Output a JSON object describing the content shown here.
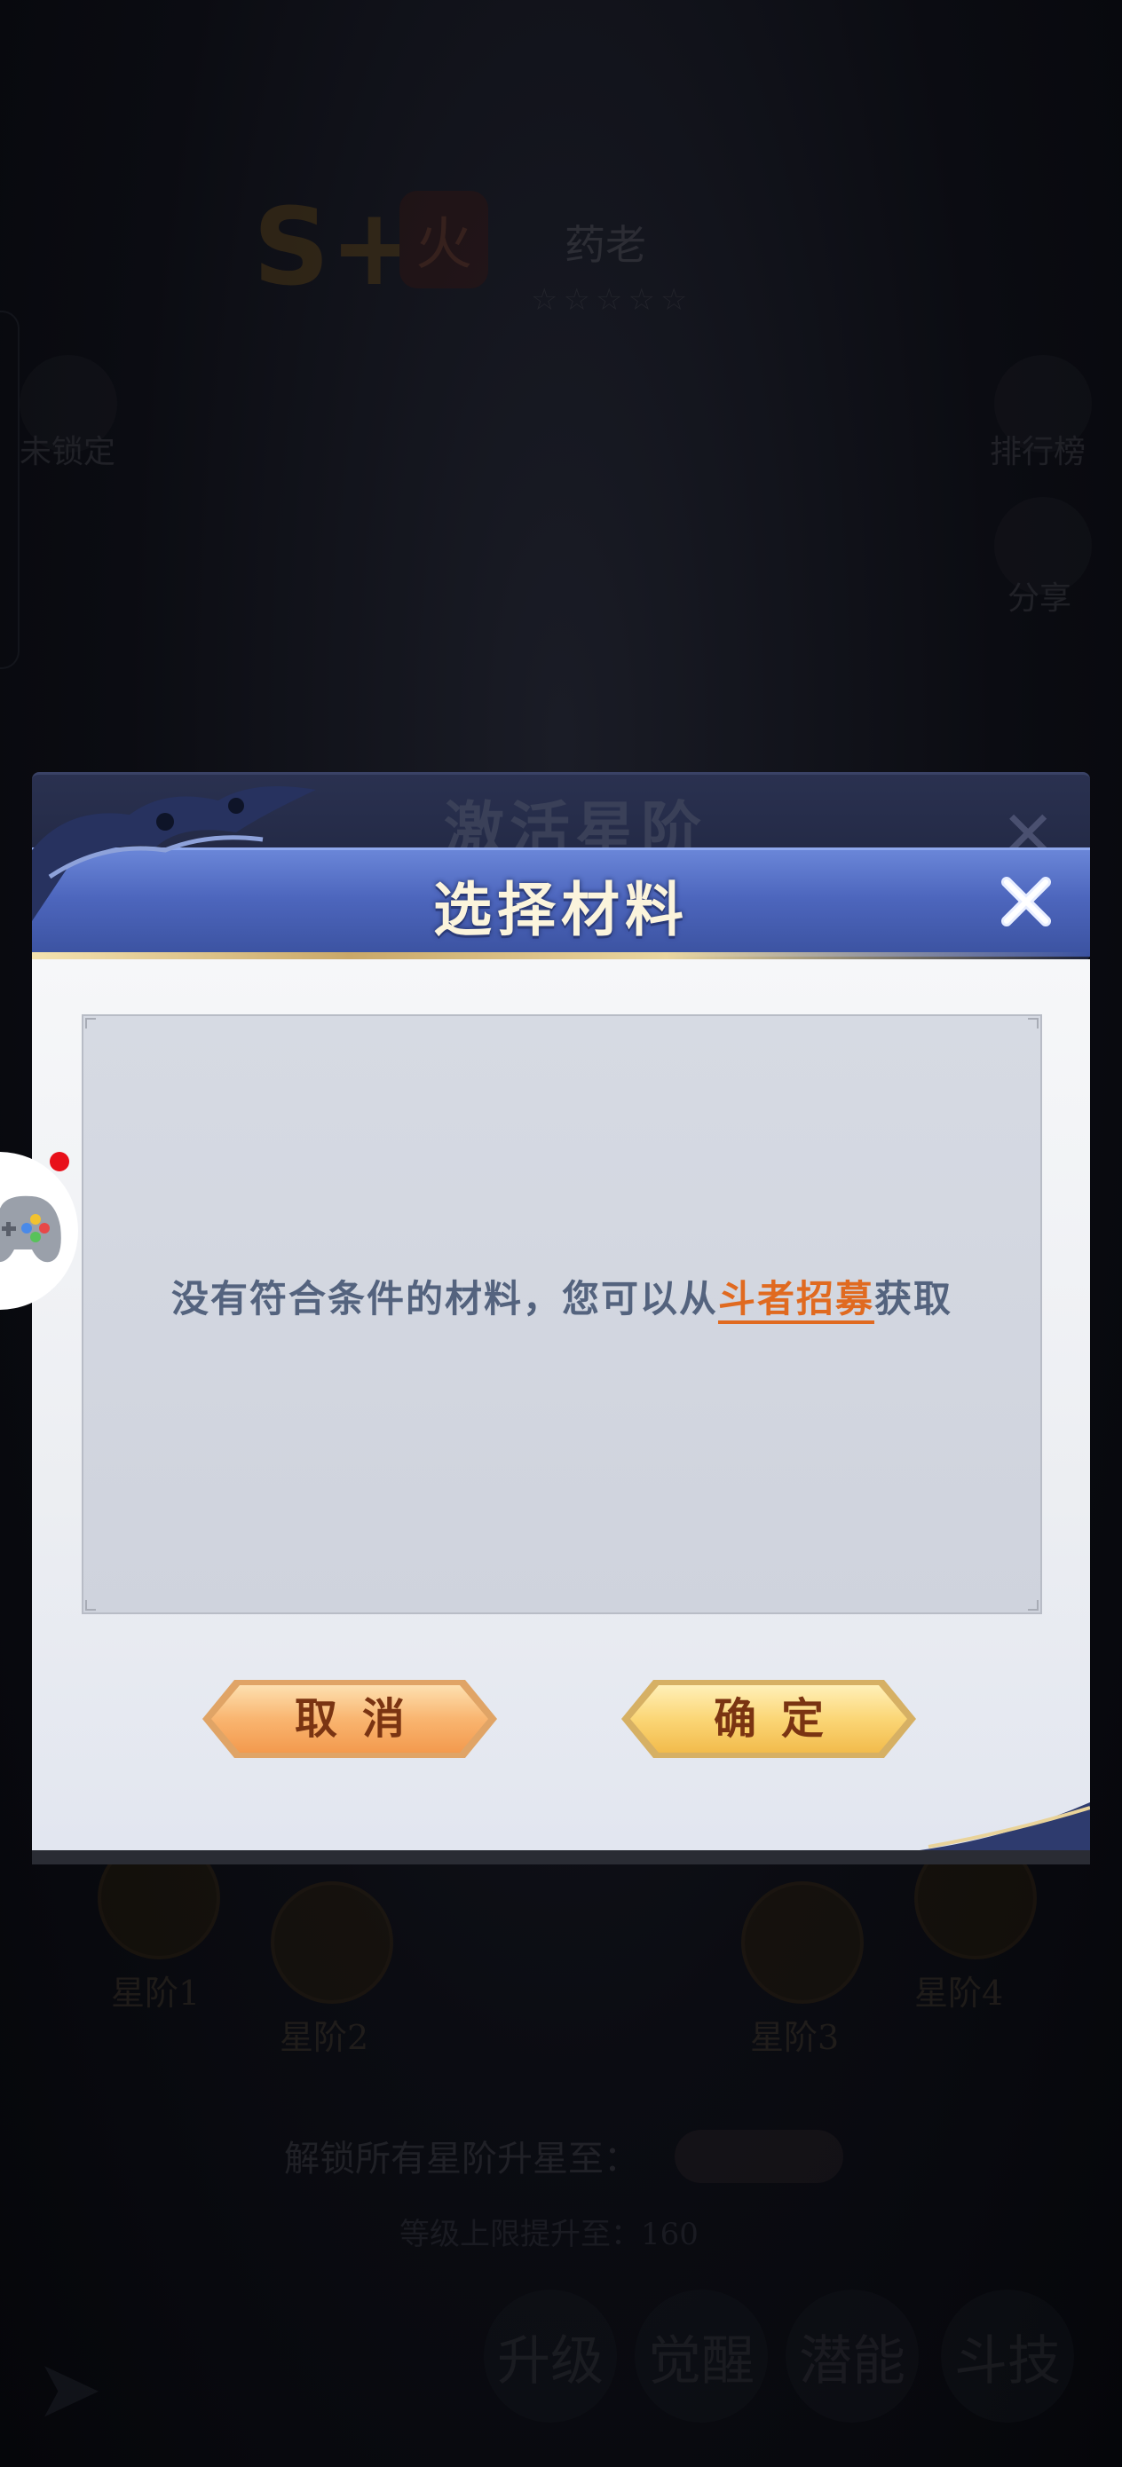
{
  "background": {
    "hero_rank": "S+",
    "hero_element": "火",
    "hero_name": "药老",
    "hero_stars": "☆☆☆☆☆",
    "left_icon_label": "未锁定",
    "right_icons": [
      {
        "label": "排行榜",
        "icon": "trophy-icon"
      },
      {
        "label": "分享",
        "icon": "share-icon"
      }
    ],
    "underlying_dialog_title": "激活星阶",
    "star_nodes": [
      {
        "label": "星阶1"
      },
      {
        "label": "星阶2"
      },
      {
        "label": "星阶3"
      },
      {
        "label": "星阶4"
      }
    ],
    "unlock_text": "解锁所有星阶升星至：",
    "level_text": "等级上限提升至：160",
    "bottom_buttons": [
      "升级",
      "觉醒",
      "潜能",
      "斗技"
    ]
  },
  "dialog": {
    "title": "选择材料",
    "message_prefix": "没有符合条件的材料，您可以从",
    "message_link": "斗者招募",
    "message_suffix": "获取",
    "cancel_label": "取消",
    "confirm_label": "确定"
  },
  "colors": {
    "header_blue": "#4d66bd",
    "link_orange": "#e06a20",
    "button_gold": "#f7c86a"
  }
}
